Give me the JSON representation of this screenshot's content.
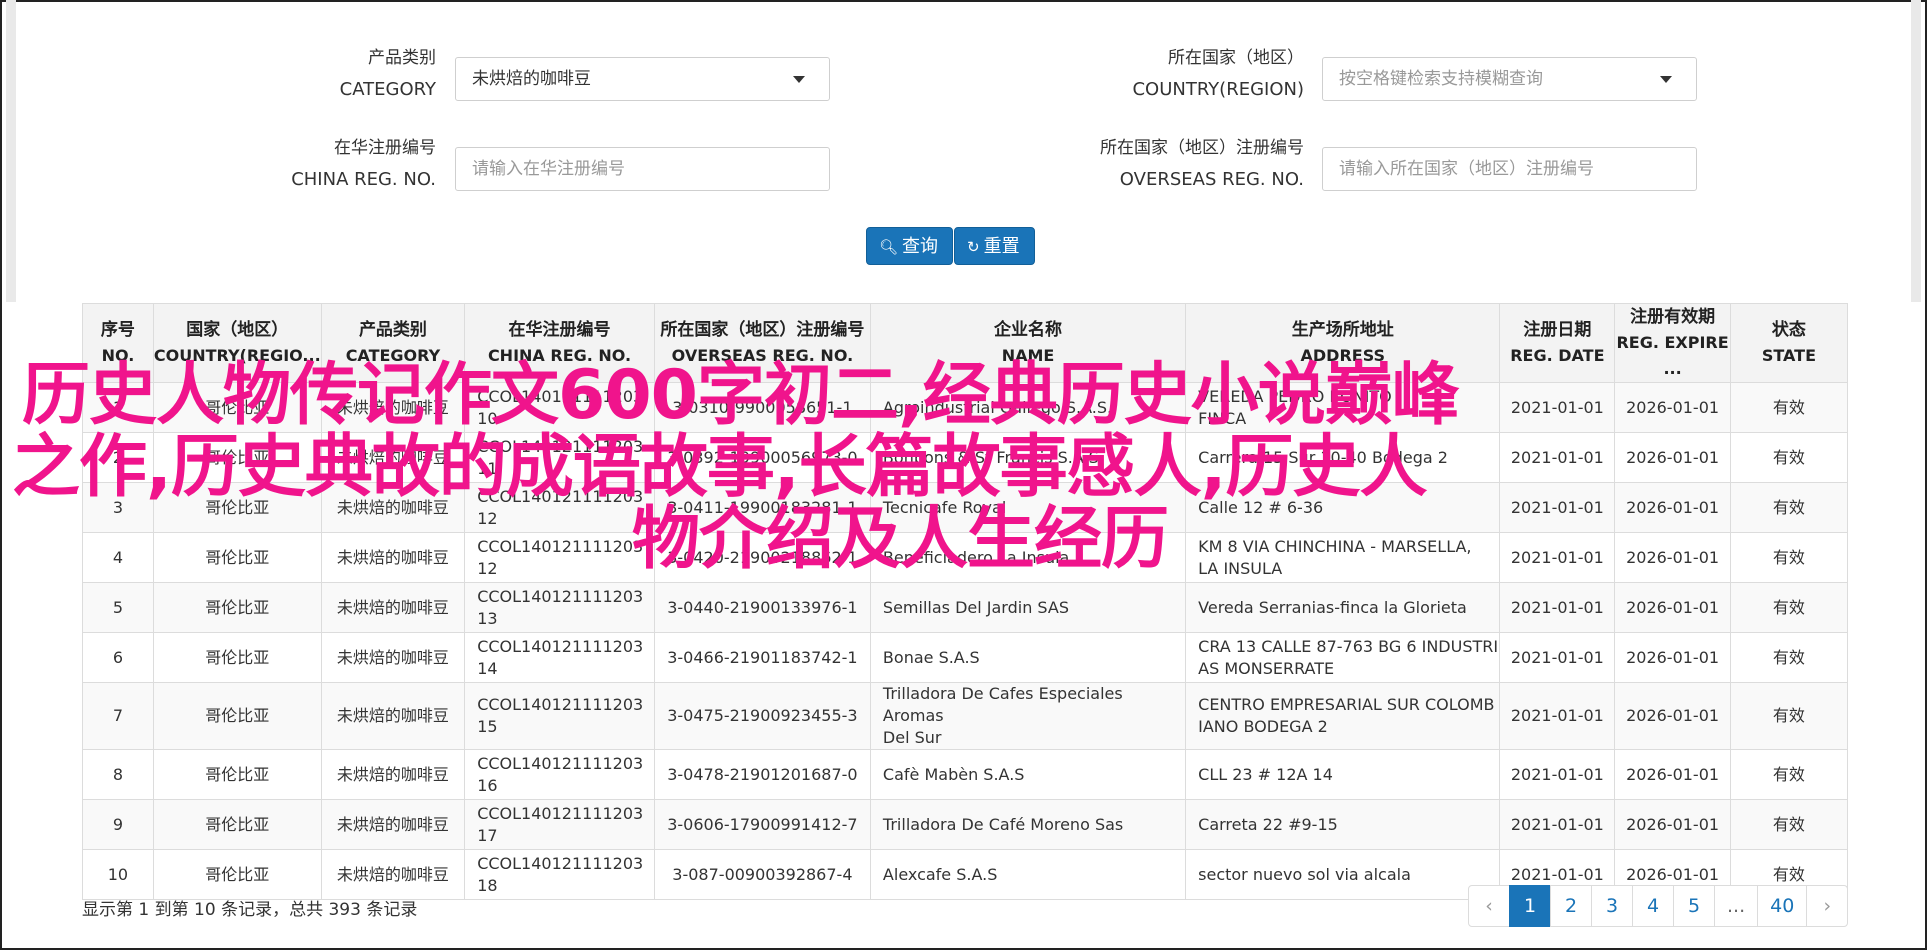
{
  "form": {
    "category_label_cn": "产品类别",
    "category_label_en": "CATEGORY",
    "category_value": "未烘焙的咖啡豆",
    "country_label_cn": "所在国家（地区）",
    "country_label_en": "COUNTRY(REGION)",
    "country_placeholder": "按空格键检索支持模糊查询",
    "china_reg_label_cn": "在华注册编号",
    "china_reg_label_en": "CHINA REG. NO.",
    "china_reg_placeholder": "请输入在华注册编号",
    "overseas_reg_label_cn": "所在国家（地区）注册编号",
    "overseas_reg_label_en": "OVERSEAS REG. NO.",
    "overseas_reg_placeholder": "请输入所在国家（地区）注册编号",
    "search_label": "查询",
    "reset_label": "重置"
  },
  "table": {
    "headers": [
      {
        "cn": "序号",
        "en": "NO."
      },
      {
        "cn": "国家（地区）",
        "en": "COUNTRY(REGIO..."
      },
      {
        "cn": "产品类别",
        "en": "CATEGORY"
      },
      {
        "cn": "在华注册编号",
        "en": "CHINA REG. NO."
      },
      {
        "cn": "所在国家（地区）注册编号",
        "en": "OVERSEAS REG. NO."
      },
      {
        "cn": "企业名称",
        "en": "NAME"
      },
      {
        "cn": "生产场所地址",
        "en": "ADDRESS"
      },
      {
        "cn": "注册日期",
        "en": "REG. DATE"
      },
      {
        "cn": "注册有效期",
        "en": "REG. EXPIRE ..."
      },
      {
        "cn": "状态",
        "en": "STATE"
      }
    ],
    "rows": [
      {
        "no": "1",
        "country": "哥伦比亚",
        "category": "未烘焙的咖啡豆",
        "china_reg": "CCOL140121111203\n10",
        "overseas_reg": "3-0310-9900058651-1",
        "name": "Agroindustrial Gallego S.A.S.",
        "address": "VEREDA PEDRO BONITO\nFINCA",
        "reg_date": "2021-01-01",
        "expire": "2026-01-01",
        "state": "有效"
      },
      {
        "no": "2",
        "country": "哥伦比亚",
        "category": "未烘焙的咖啡豆",
        "china_reg": "CCOL140121111203\n11",
        "overseas_reg": "3-0392-19900056973-0",
        "name": "Bonbons & St Francis S.A.S.",
        "address": "Carrera 15 Sur 30-40 Bodega 2",
        "reg_date": "2021-01-01",
        "expire": "2026-01-01",
        "state": "有效"
      },
      {
        "no": "3",
        "country": "哥伦比亚",
        "category": "未烘焙的咖啡豆",
        "china_reg": "CCOL140121111203\n12",
        "overseas_reg": "3-0411-19900183281-1",
        "name": "Tecnicafe Royal",
        "address": "Calle 12 # 6-36",
        "reg_date": "2021-01-01",
        "expire": "2026-01-01",
        "state": "有效"
      },
      {
        "no": "4",
        "country": "哥伦比亚",
        "category": "未烘焙的咖啡豆",
        "china_reg": "CCOL140121111203\n12",
        "overseas_reg": "3-0420-21900218862-1",
        "name": "Beneficiadero La Insula",
        "address": "KM 8 VIA CHINCHINA - MARSELLA,\nLA INSULA",
        "reg_date": "2021-01-01",
        "expire": "2026-01-01",
        "state": "有效"
      },
      {
        "no": "5",
        "country": "哥伦比亚",
        "category": "未烘焙的咖啡豆",
        "china_reg": "CCOL140121111203\n13",
        "overseas_reg": "3-0440-21900133976-1",
        "name": "Semillas Del Jardin SAS",
        "address": "Vereda Serranias-finca la Glorieta",
        "reg_date": "2021-01-01",
        "expire": "2026-01-01",
        "state": "有效"
      },
      {
        "no": "6",
        "country": "哥伦比亚",
        "category": "未烘焙的咖啡豆",
        "china_reg": "CCOL140121111203\n14",
        "overseas_reg": "3-0466-21901183742-1",
        "name": "Bonae S.A.S",
        "address": "CRA 13 CALLE 87-763 BG 6 INDUSTRI\nAS MONSERRATE",
        "reg_date": "2021-01-01",
        "expire": "2026-01-01",
        "state": "有效"
      },
      {
        "no": "7",
        "country": "哥伦比亚",
        "category": "未烘焙的咖啡豆",
        "china_reg": "CCOL140121111203\n15",
        "overseas_reg": "3-0475-21900923455-3",
        "name": "Trilladora De Cafes Especiales Aromas\nDel Sur",
        "address": "CENTRO EMPRESARIAL SUR COLOMB\nIANO BODEGA 2",
        "reg_date": "2021-01-01",
        "expire": "2026-01-01",
        "state": "有效"
      },
      {
        "no": "8",
        "country": "哥伦比亚",
        "category": "未烘焙的咖啡豆",
        "china_reg": "CCOL140121111203\n16",
        "overseas_reg": "3-0478-21901201687-0",
        "name": "Cafè Mabèn S.A.S",
        "address": "CLL 23 # 12A 14",
        "reg_date": "2021-01-01",
        "expire": "2026-01-01",
        "state": "有效"
      },
      {
        "no": "9",
        "country": "哥伦比亚",
        "category": "未烘焙的咖啡豆",
        "china_reg": "CCOL140121111203\n17",
        "overseas_reg": "3-0606-17900991412-7",
        "name": "Trilladora De Café Moreno Sas",
        "address": "Carreta 22 #9-15",
        "reg_date": "2021-01-01",
        "expire": "2026-01-01",
        "state": "有效"
      },
      {
        "no": "10",
        "country": "哥伦比亚",
        "category": "未烘焙的咖啡豆",
        "china_reg": "CCOL140121111203\n18",
        "overseas_reg": "3-087-00900392867-4",
        "name": "Alexcafe S.A.S",
        "address": "sector nuevo sol via alcala",
        "reg_date": "2021-01-01",
        "expire": "2026-01-01",
        "state": "有效"
      }
    ]
  },
  "footer": {
    "summary": "显示第 1 到第 10 条记录，总共 393 条记录",
    "pages": [
      "‹",
      "1",
      "2",
      "3",
      "4",
      "5",
      "...",
      "40",
      "›"
    ],
    "active_page": "1"
  },
  "overlay": {
    "line1": "历史人物传记作文600字初二,经典历史小说巅峰",
    "line2": "之作,历史典故的成语故事,长篇故事感人,历史人",
    "line3": "物介绍及人生经历"
  },
  "colors": {
    "primary": "#1a74b8",
    "overlay_text": "#f0148c"
  }
}
